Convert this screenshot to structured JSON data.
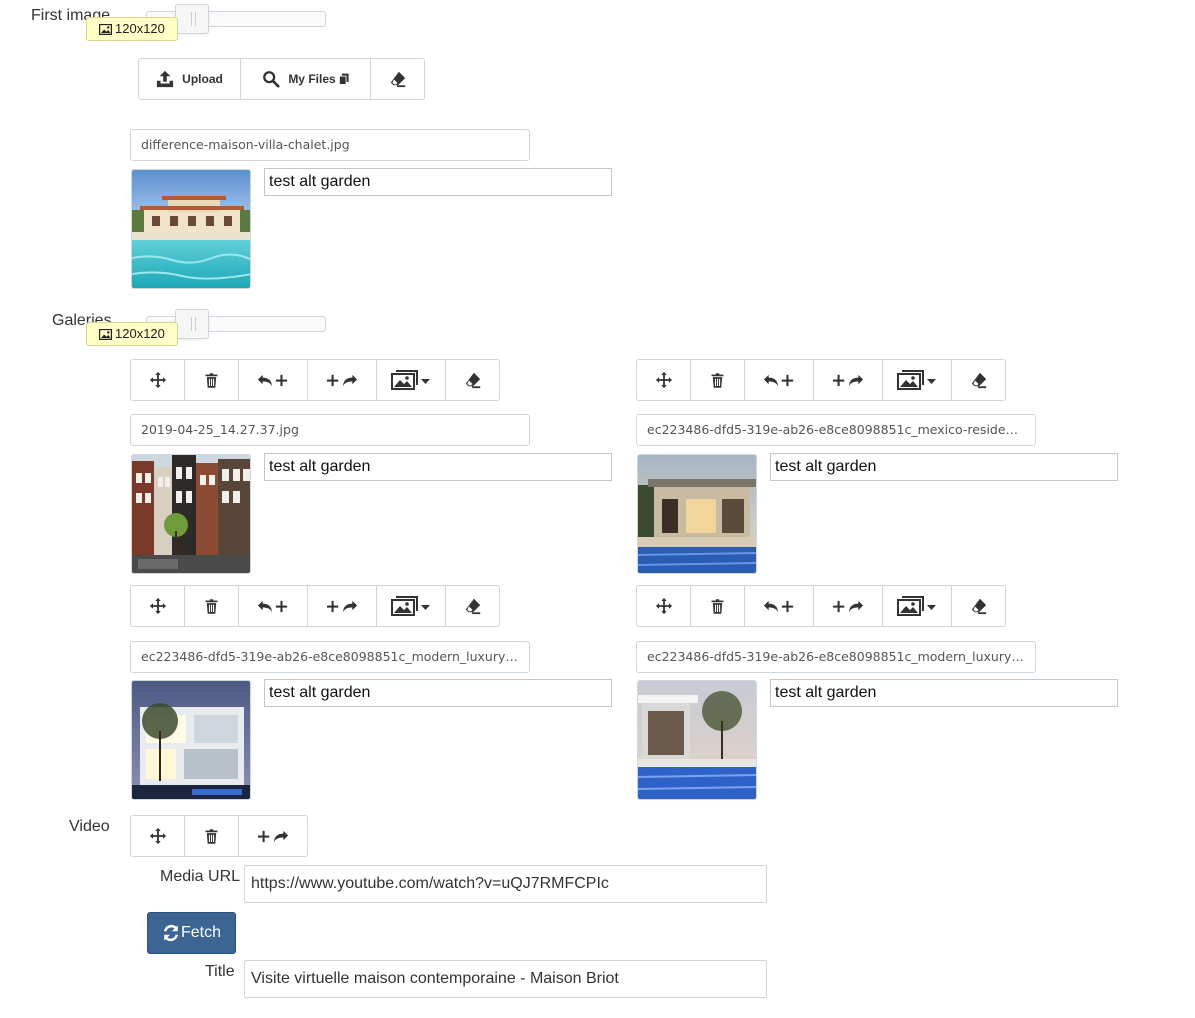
{
  "first_image": {
    "label": "First image",
    "size_badge": "120x120",
    "toolbar": {
      "upload_label": "Upload",
      "my_files_label": "My Files"
    },
    "filename": "difference-maison-villa-chalet.jpg",
    "alt": "test alt garden",
    "thumbnail": "villa with pool"
  },
  "galleries": {
    "label": "Galeries",
    "size_badge": "120x120",
    "items": [
      {
        "filename": "2019-04-25_14.27.37.jpg",
        "alt": "test alt garden",
        "thumbnail": "amsterdam canal houses"
      },
      {
        "filename": "ec223486-dfd5-319e-ab26-e8ce8098851c_mexico-residence-mod...",
        "alt": "test alt garden",
        "thumbnail": "modern residence with pool"
      },
      {
        "filename": "ec223486-dfd5-319e-ab26-e8ce8098851c_modern_luxury_house...",
        "alt": "test alt garden",
        "thumbnail": "modern luxury house at night"
      },
      {
        "filename": "ec223486-dfd5-319e-ab26-e8ce8098851c_modern_luxury_house...",
        "alt": "test alt garden",
        "thumbnail": "modern house with pool at dusk"
      }
    ]
  },
  "video": {
    "label": "Video",
    "media_url_label": "Media URL",
    "media_url_value": "https://www.youtube.com/watch?v=uQJ7RMFCPIc",
    "fetch_label": "Fetch",
    "title_label": "Title",
    "title_value": "Visite virtuelle maison contemporaine - Maison Briot"
  },
  "colors": {
    "fetch_button": "#3d6594",
    "badge_background": "#ffffc7",
    "border": "#cfd6dc"
  }
}
